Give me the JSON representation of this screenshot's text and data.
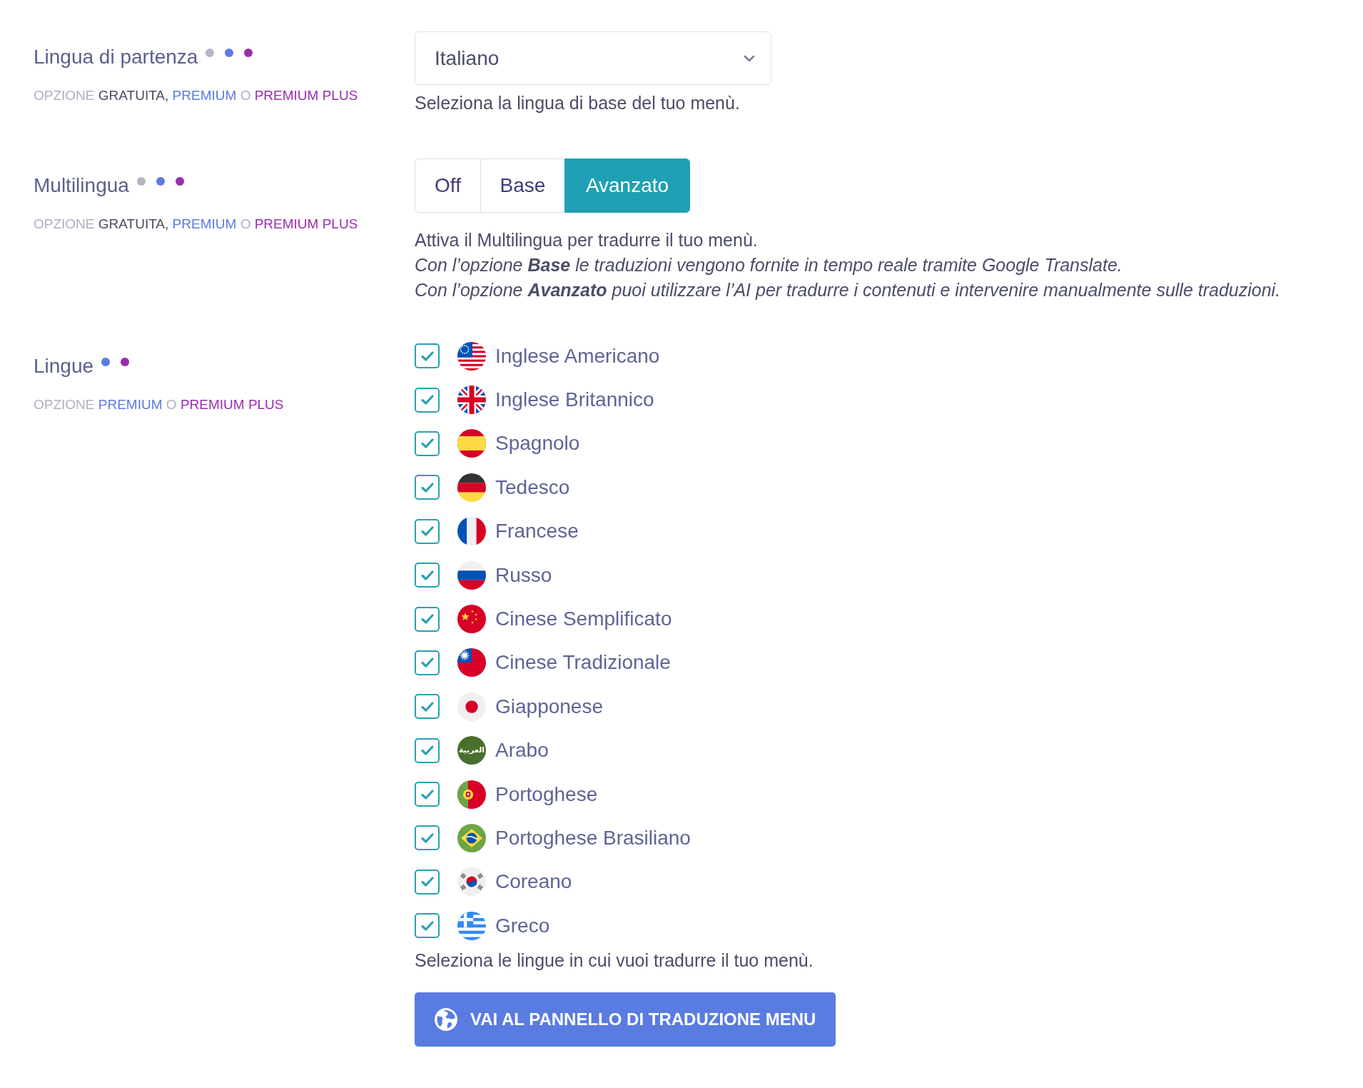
{
  "sections": [
    {
      "kind": "select",
      "label": "Lingua di partenza",
      "tiers": [
        {
          "color": "#b4b5c8"
        },
        {
          "color": "#5a7be3"
        },
        {
          "color": "#9b2cb0"
        }
      ],
      "availability": [
        {
          "text": "OPZIONE",
          "color": "#aeb0c2"
        },
        {
          "text": "GRATUITA,",
          "color": "#4a4b5c"
        },
        {
          "text": "PREMIUM",
          "color": "#5a7be3"
        },
        {
          "text": "O",
          "color": "#aeb0c2"
        },
        {
          "text": "PREMIUM PLUS",
          "color": "#9b2cb0"
        }
      ],
      "select": {
        "value": "Italiano"
      },
      "help": [
        {
          "kind": "plain",
          "text": "Seleziona la lingua di base del tuo menù."
        }
      ]
    },
    {
      "kind": "segmented",
      "label": "Multilingua",
      "tiers": [
        {
          "color": "#b4b5c8"
        },
        {
          "color": "#5a7be3"
        },
        {
          "color": "#9b2cb0"
        }
      ],
      "availability": [
        {
          "text": "OPZIONE",
          "color": "#aeb0c2"
        },
        {
          "text": "GRATUITA,",
          "color": "#4a4b5c"
        },
        {
          "text": "PREMIUM",
          "color": "#5a7be3"
        },
        {
          "text": "O",
          "color": "#aeb0c2"
        },
        {
          "text": "PREMIUM PLUS",
          "color": "#9b2cb0"
        }
      ],
      "modes": [
        {
          "label": "Off",
          "selected": false
        },
        {
          "label": "Base",
          "selected": false
        },
        {
          "label": "Avanzato",
          "selected": true
        }
      ],
      "help": [
        {
          "kind": "plain",
          "text": "Attiva il Multilingua per tradurre il tuo menù."
        },
        {
          "kind": "note",
          "text": "Con l’opzione **Base** le traduzioni vengono fornite in tempo reale tramite Google Translate."
        },
        {
          "kind": "note",
          "text": "Con l’opzione **Avanzato** puoi utilizzare l’AI per tradurre i contenuti e intervenire manualmente sulle traduzioni."
        }
      ]
    },
    {
      "kind": "checklist",
      "label": "Lingue",
      "tiers": [
        {
          "color": "#5a7be3"
        },
        {
          "color": "#9b2cb0"
        }
      ],
      "availability": [
        {
          "text": "OPZIONE",
          "color": "#aeb0c2"
        },
        {
          "text": "PREMIUM",
          "color": "#5a7be3"
        },
        {
          "text": "O",
          "color": "#aeb0c2"
        },
        {
          "text": "PREMIUM PLUS",
          "color": "#9b2cb0"
        }
      ],
      "languages": [
        {
          "label": "Inglese Americano",
          "checked": true
        },
        {
          "label": "Inglese Britannico",
          "checked": true
        },
        {
          "label": "Spagnolo",
          "checked": true
        },
        {
          "label": "Tedesco",
          "checked": true
        },
        {
          "label": "Francese",
          "checked": true
        },
        {
          "label": "Russo",
          "checked": true
        },
        {
          "label": "Cinese Semplificato",
          "checked": true
        },
        {
          "label": "Cinese Tradizionale",
          "checked": true
        },
        {
          "label": "Giapponese",
          "checked": true
        },
        {
          "label": "Arabo",
          "checked": true,
          "badge": "العربية"
        },
        {
          "label": "Portoghese",
          "checked": true
        },
        {
          "label": "Portoghese Brasiliano",
          "checked": true
        },
        {
          "label": "Coreano",
          "checked": true
        },
        {
          "label": "Greco",
          "checked": true
        }
      ],
      "help": [
        {
          "kind": "plain",
          "text": "Seleziona le lingue in cui vuoi tradurre il tuo menù."
        }
      ],
      "button": {
        "label": "VAI AL PANNELLO DI TRADUZIONE MENU"
      }
    }
  ]
}
